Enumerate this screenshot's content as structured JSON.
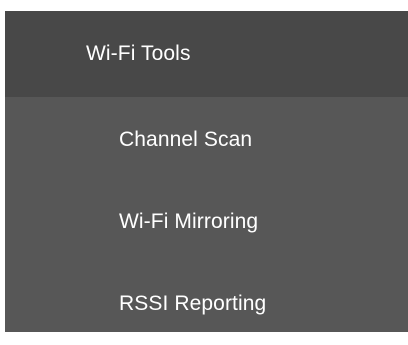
{
  "menu": {
    "header": {
      "label": "Wi-Fi Tools"
    },
    "items": [
      {
        "label": "Channel Scan"
      },
      {
        "label": "Wi-Fi Mirroring"
      },
      {
        "label": "RSSI Reporting"
      }
    ]
  },
  "colors": {
    "header_bg": "#484848",
    "menu_bg": "#575757",
    "text": "#ffffff"
  }
}
